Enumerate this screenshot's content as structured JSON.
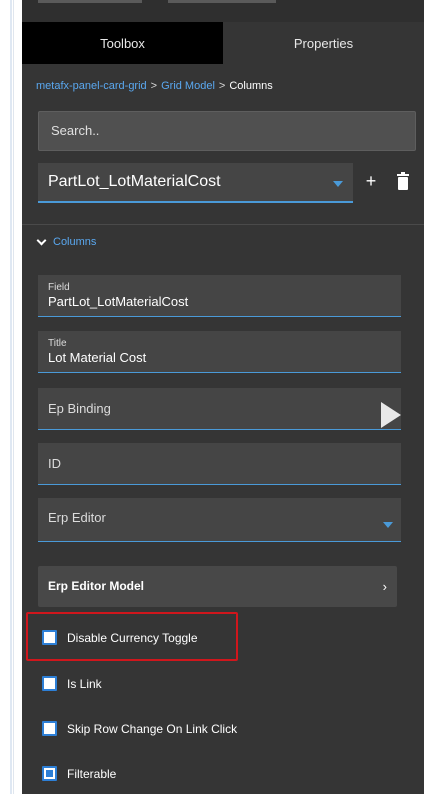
{
  "tabs": [
    {
      "label": "Toolbox",
      "active": true
    },
    {
      "label": "Properties",
      "active": false
    }
  ],
  "breadcrumb": {
    "items": [
      "metafx-panel-card-grid",
      "Grid Model",
      "Columns"
    ],
    "separator": ">"
  },
  "search": {
    "placeholder": "Search.."
  },
  "selector": {
    "value": "PartLot_LotMaterialCost",
    "add_icon": "plus-icon",
    "delete_icon": "trash-icon"
  },
  "section": {
    "label": "Columns",
    "expanded": true
  },
  "fields": {
    "field": {
      "label": "Field",
      "value": "PartLot_LotMaterialCost"
    },
    "title": {
      "label": "Title",
      "value": "Lot Material Cost"
    },
    "ep_binding": {
      "placeholder": "Ep Binding"
    },
    "id": {
      "placeholder": "ID"
    },
    "erp_editor": {
      "placeholder": "Erp Editor"
    }
  },
  "erp_editor_model": {
    "label": "Erp Editor Model",
    "arrow": "›"
  },
  "checkboxes": [
    {
      "label": "Disable Currency Toggle",
      "checked": false,
      "highlighted": true
    },
    {
      "label": "Is Link",
      "checked": false
    },
    {
      "label": "Skip Row Change On Link Click",
      "checked": false
    },
    {
      "label": "Filterable",
      "checked": false,
      "focused": true
    }
  ],
  "colors": {
    "panel_bg": "#353535",
    "active_tab_bg": "#000000",
    "accent_blue": "#4a9ad8",
    "link_blue": "#5aa8f0",
    "highlight_red": "#d0161c"
  }
}
